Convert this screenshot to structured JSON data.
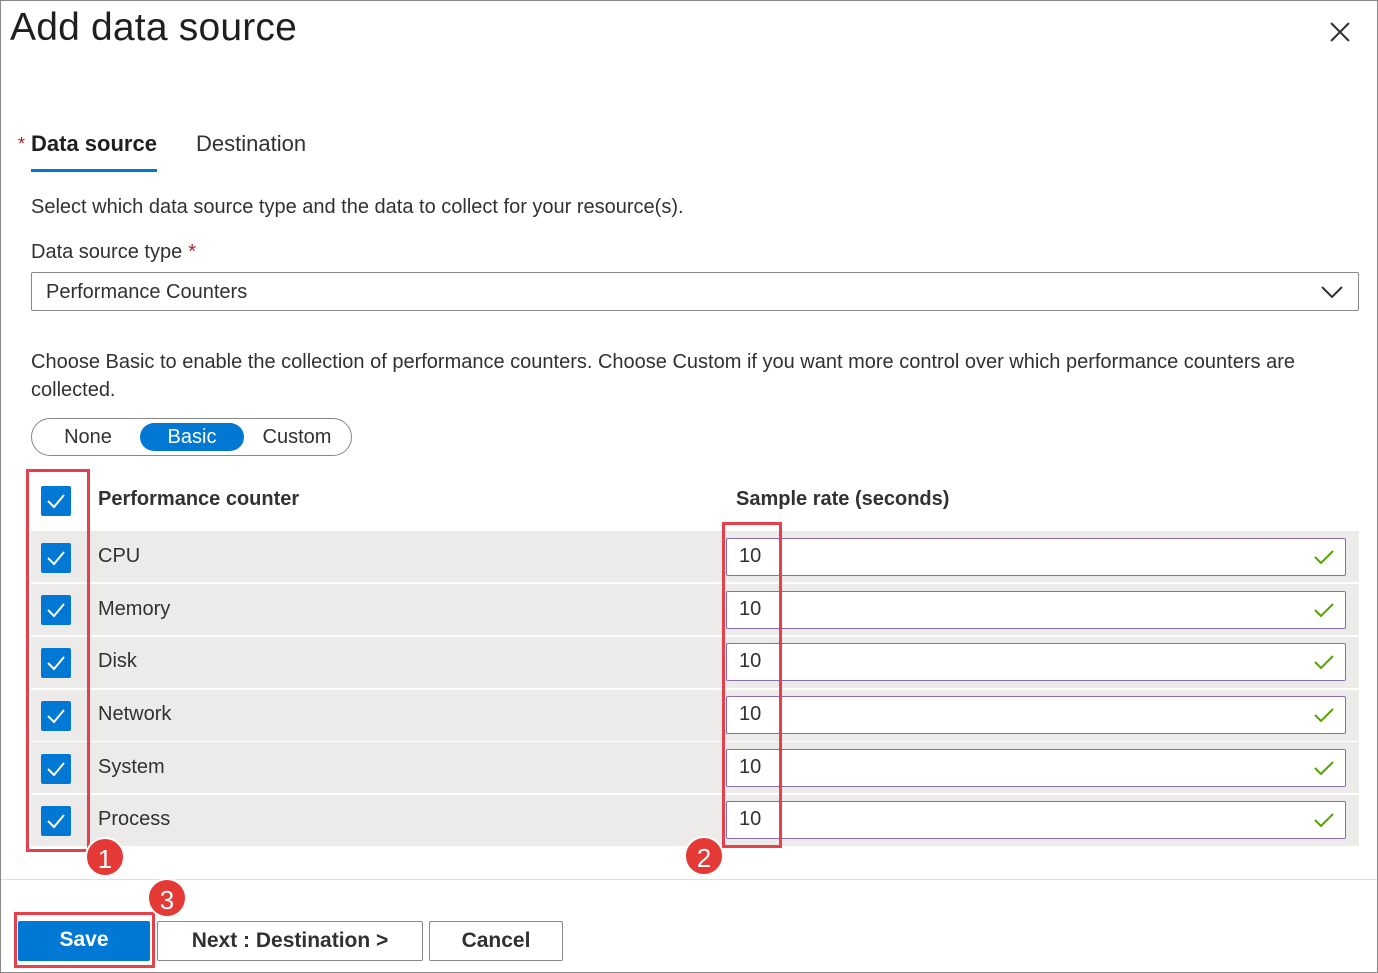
{
  "dialog": {
    "title": "Add data source",
    "close_icon": "close-icon"
  },
  "tabs": [
    {
      "label": "Data source",
      "active": true,
      "required": true
    },
    {
      "label": "Destination",
      "active": false
    }
  ],
  "description": "Select which data source type and the data to collect for your resource(s).",
  "data_source_type": {
    "label": "Data source type",
    "required_marker": "*",
    "value": "Performance Counters"
  },
  "info_text": "Choose Basic to enable the collection of performance counters. Choose Custom if you want more control over which performance counters are collected.",
  "mode_toggle": {
    "options": [
      "None",
      "Basic",
      "Custom"
    ],
    "selected": "Basic"
  },
  "table": {
    "headers": {
      "counter": "Performance counter",
      "rate": "Sample rate (seconds)"
    },
    "select_all_checked": true,
    "rows": [
      {
        "counter": "CPU",
        "rate": "10",
        "checked": true
      },
      {
        "counter": "Memory",
        "rate": "10",
        "checked": true
      },
      {
        "counter": "Disk",
        "rate": "10",
        "checked": true
      },
      {
        "counter": "Network",
        "rate": "10",
        "checked": true
      },
      {
        "counter": "System",
        "rate": "10",
        "checked": true
      },
      {
        "counter": "Process",
        "rate": "10",
        "checked": true
      }
    ]
  },
  "buttons": {
    "save": "Save",
    "next": "Next : Destination >",
    "cancel": "Cancel"
  },
  "annotations": [
    "1",
    "2",
    "3"
  ],
  "colors": {
    "accent": "#0078d4",
    "required": "#a4262c",
    "annotation": "#e53935",
    "valid_check": "#57a300"
  }
}
